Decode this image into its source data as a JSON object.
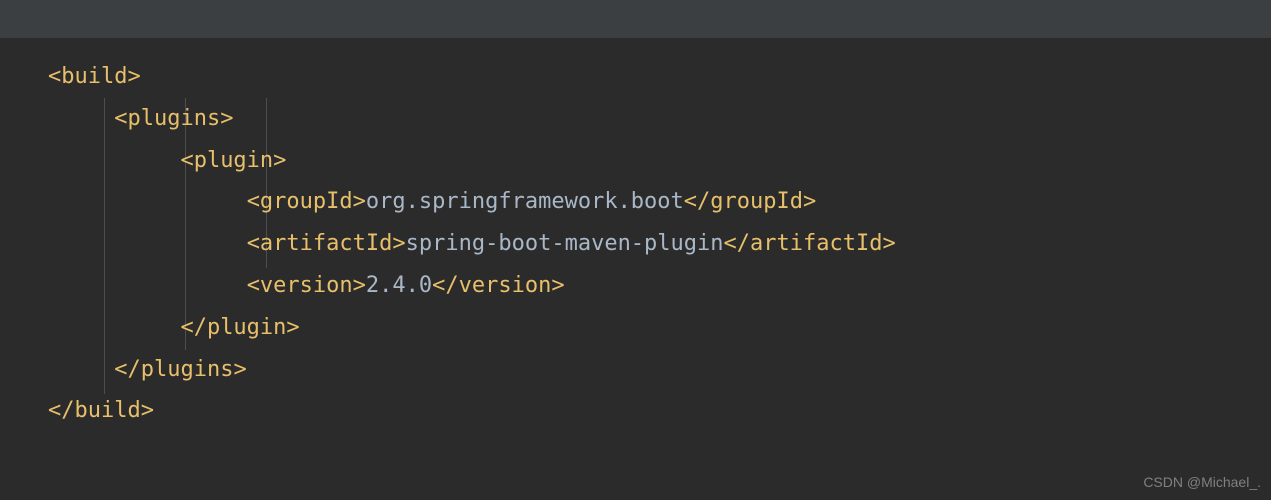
{
  "code": {
    "lines": [
      {
        "indent": 0,
        "tagOpen": "<build>",
        "content": "",
        "tagClose": ""
      },
      {
        "indent": 1,
        "tagOpen": "<plugins>",
        "content": "",
        "tagClose": ""
      },
      {
        "indent": 2,
        "tagOpen": "<plugin>",
        "content": "",
        "tagClose": ""
      },
      {
        "indent": 3,
        "tagOpen": "<groupId>",
        "content": "org.springframework.boot",
        "tagClose": "</groupId>"
      },
      {
        "indent": 3,
        "tagOpen": "<artifactId>",
        "content": "spring-boot-maven-plugin",
        "tagClose": "</artifactId>"
      },
      {
        "indent": 3,
        "tagOpen": "<version>",
        "content": "2.4.0",
        "tagClose": "</version>"
      },
      {
        "indent": 2,
        "tagOpen": "</plugin>",
        "content": "",
        "tagClose": ""
      },
      {
        "indent": 1,
        "tagOpen": "</plugins>",
        "content": "",
        "tagClose": ""
      },
      {
        "indent": 0,
        "tagOpen": "</build>",
        "content": "",
        "tagClose": ""
      }
    ]
  },
  "watermark": "CSDN @Michael_."
}
